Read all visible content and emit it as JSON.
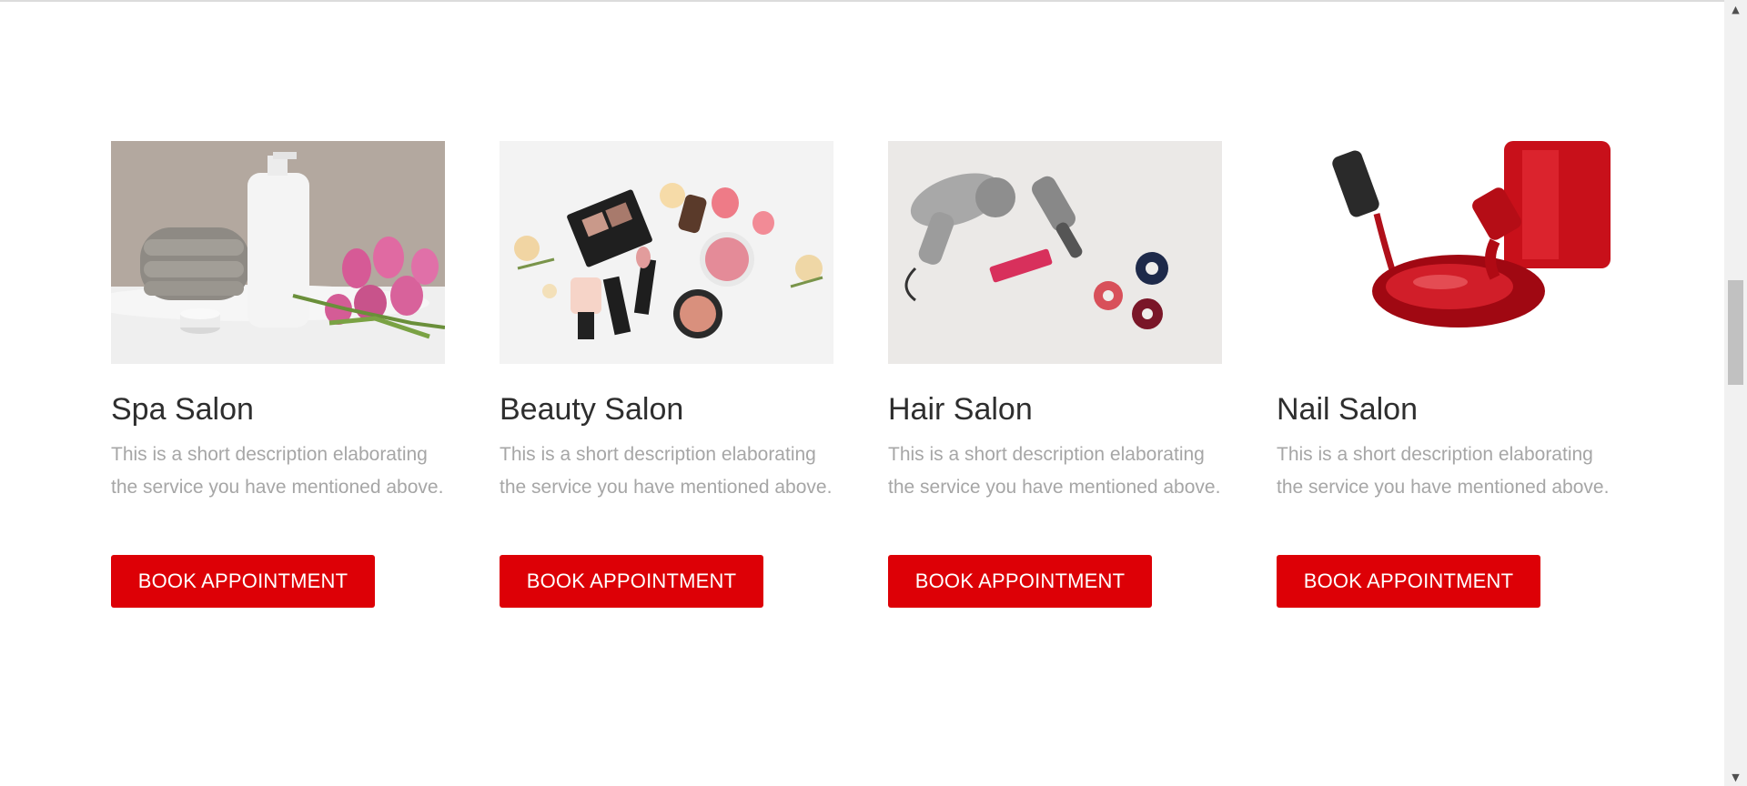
{
  "services": [
    {
      "title": "Spa Salon",
      "description": "This is a short description elaborating the service you have mentioned above.",
      "button_label": "BOOK APPOINTMENT",
      "image": "spa-products-image"
    },
    {
      "title": "Beauty Salon",
      "description": "This is a short description elaborating the service you have mentioned above.",
      "button_label": "BOOK APPOINTMENT",
      "image": "makeup-flatlay-image"
    },
    {
      "title": "Hair Salon",
      "description": "This is a short description elaborating the service you have mentioned above.",
      "button_label": "BOOK APPOINTMENT",
      "image": "hair-tools-image"
    },
    {
      "title": "Nail Salon",
      "description": "This is a short description elaborating the service you have mentioned above.",
      "button_label": "BOOK APPOINTMENT",
      "image": "nail-polish-image"
    }
  ],
  "colors": {
    "button_bg": "#dd0006",
    "title_text": "#2e2e2e",
    "description_text": "#a6a6a6"
  },
  "scrollbar": {
    "up_icon": "triangle-up-icon",
    "down_icon": "triangle-down-icon"
  }
}
